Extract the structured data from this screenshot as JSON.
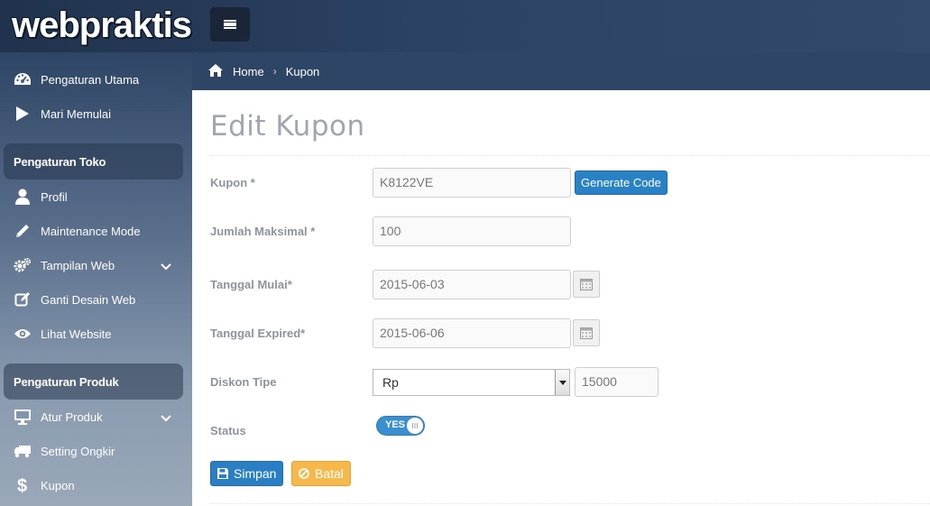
{
  "brand": {
    "logo_text": "webpraktis"
  },
  "sidebar": {
    "items_top": [
      {
        "label": "Pengaturan Utama",
        "icon": "dashboard-icon"
      },
      {
        "label": "Mari Memulai",
        "icon": "play-icon"
      }
    ],
    "section_toko": "Pengaturan Toko",
    "items_toko": [
      {
        "label": "Profil",
        "icon": "user-icon"
      },
      {
        "label": "Maintenance Mode",
        "icon": "pencil-icon"
      },
      {
        "label": "Tampilan Web",
        "icon": "gears-icon",
        "expandable": true
      },
      {
        "label": "Ganti Desain Web",
        "icon": "edit-icon"
      },
      {
        "label": "Lihat Website",
        "icon": "eye-icon"
      }
    ],
    "section_produk": "Pengaturan Produk",
    "items_produk": [
      {
        "label": "Atur Produk",
        "icon": "monitor-icon",
        "expandable": true
      },
      {
        "label": "Setting Ongkir",
        "icon": "truck-icon"
      },
      {
        "label": "Kupon",
        "icon": "dollar-icon"
      }
    ]
  },
  "breadcrumb": {
    "home": "Home",
    "current": "Kupon"
  },
  "page": {
    "title": "Edit Kupon"
  },
  "form": {
    "kupon": {
      "label": "Kupon *",
      "value": "K8122VE",
      "generate_label": "Generate Code"
    },
    "jumlah": {
      "label": "Jumlah Maksimal *",
      "value": "100"
    },
    "tanggal_mulai": {
      "label": "Tanggal Mulai*",
      "value": "2015-06-03"
    },
    "tanggal_expired": {
      "label": "Tanggal Expired*",
      "value": "2015-06-06"
    },
    "diskon": {
      "label": "Diskon Tipe",
      "type_selected": "Rp",
      "amount": "15000"
    },
    "status": {
      "label": "Status",
      "toggle_text": "YES",
      "on": true
    },
    "save_label": "Simpan",
    "cancel_label": "Batal"
  },
  "colors": {
    "primary": "#2a7fc4",
    "warning": "#f7b84b",
    "navbar": "#2f4565"
  }
}
